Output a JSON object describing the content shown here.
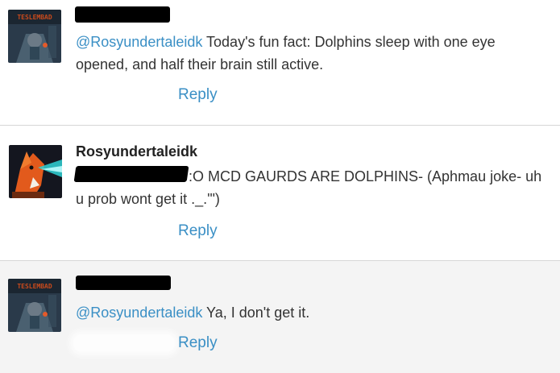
{
  "comments": [
    {
      "mention": "@Rosyundertaleidk",
      "text": " Today's fun fact: Dolphins sleep with one eye opened, and half their brain still active.",
      "reply_label": "Reply",
      "avatar_caption": "TESLEMBAD"
    },
    {
      "author": "Rosyundertaleidk",
      "text": ":O MCD GAURDS ARE DOLPHINS- (Aphmau joke- uh u prob wont get it ._.'\")",
      "reply_label": "Reply"
    },
    {
      "mention": "@Rosyundertaleidk",
      "text": " Ya, I don't get it.",
      "reply_label": "Reply",
      "avatar_caption": "TESLEMBAD"
    }
  ],
  "colors": {
    "link": "#3a8fc5",
    "divider": "#d6d6d6",
    "highlight_bg": "#f4f4f4"
  },
  "icons": [
    "game-avatar-icon",
    "fox-avatar-icon"
  ]
}
